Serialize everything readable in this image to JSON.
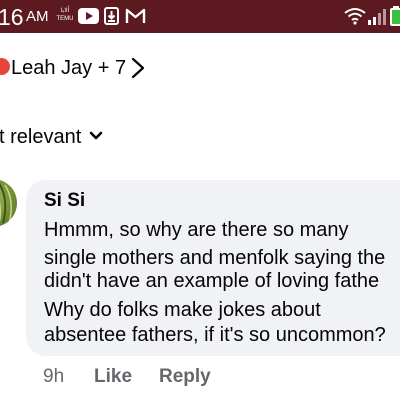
{
  "status_bar": {
    "time": "16",
    "ampm": "AM",
    "temu_badge": "TEMU",
    "background": "#5c1a20",
    "icons": [
      "temu-icon",
      "youtube-icon",
      "download-icon",
      "gmail-icon",
      "wifi-icon",
      "signal-icon",
      "battery-icon"
    ]
  },
  "reactions": {
    "summary": "Leah Jay + 7",
    "badge_color": "#e8443a"
  },
  "filter": {
    "label": "t relevant"
  },
  "comment": {
    "author": "Si Si",
    "lines": [
      "Hmmm, so why are there so many",
      "single mothers and menfolk saying the",
      "didn't have an example of loving fathe",
      "Why do folks make jokes about",
      "absentee fathers, if it's so uncommon?"
    ],
    "time": "9h",
    "like_label": "Like",
    "reply_label": "Reply",
    "bubble_color": "#f0f2f5"
  }
}
